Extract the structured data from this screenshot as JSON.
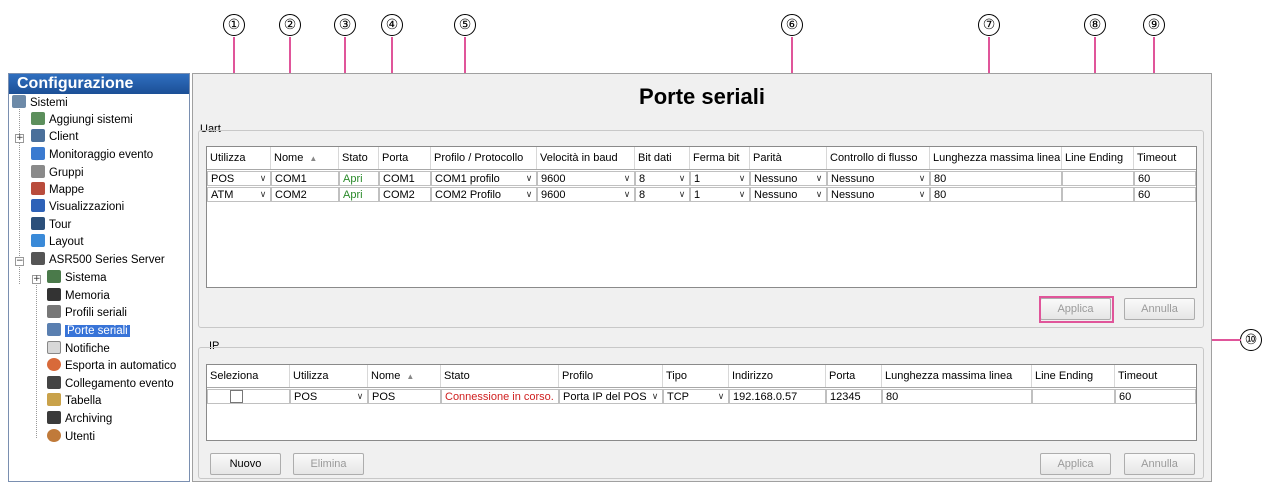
{
  "callouts": [
    "①",
    "②",
    "③",
    "④",
    "⑤",
    "⑥",
    "⑦",
    "⑧",
    "⑨",
    "⑩"
  ],
  "sidebar": {
    "title": "Configurazione",
    "items": [
      {
        "label": "Sistemi",
        "icon": "systems-icon"
      },
      {
        "label": "Aggiungi sistemi",
        "icon": "add-system-icon"
      },
      {
        "label": "Client",
        "icon": "client-icon"
      },
      {
        "label": "Monitoraggio evento",
        "icon": "event-monitor-icon"
      },
      {
        "label": "Gruppi",
        "icon": "groups-icon"
      },
      {
        "label": "Mappe",
        "icon": "maps-icon"
      },
      {
        "label": "Visualizzazioni",
        "icon": "views-icon"
      },
      {
        "label": "Tour",
        "icon": "tour-icon"
      },
      {
        "label": "Layout",
        "icon": "layout-icon"
      },
      {
        "label": "ASR500 Series Server",
        "icon": "server-icon"
      },
      {
        "label": "Sistema",
        "icon": "system-icon"
      },
      {
        "label": "Memoria",
        "icon": "memory-icon"
      },
      {
        "label": "Profili seriali",
        "icon": "serial-profiles-icon"
      },
      {
        "label": "Porte seriali",
        "icon": "serial-ports-icon"
      },
      {
        "label": "Notifiche",
        "icon": "notifications-icon"
      },
      {
        "label": "Esporta in automatico",
        "icon": "auto-export-icon"
      },
      {
        "label": "Collegamento evento",
        "icon": "event-link-icon"
      },
      {
        "label": "Tabella",
        "icon": "table-icon"
      },
      {
        "label": "Archiving",
        "icon": "archiving-icon"
      },
      {
        "label": "Utenti",
        "icon": "users-icon"
      }
    ]
  },
  "main": {
    "title": "Porte seriali",
    "uart": {
      "label": "Uart",
      "columns": [
        "Utilizza",
        "Nome",
        "Stato",
        "Porta",
        "Profilo / Protocollo",
        "Velocità in baud",
        "Bit dati",
        "Ferma bit",
        "Parità",
        "Controllo di flusso",
        "Lunghezza massima linea",
        "Line Ending",
        "Timeout"
      ],
      "rows": [
        [
          "POS",
          "COM1",
          "Apri",
          "COM1",
          "COM1 profilo",
          "9600",
          "8",
          "1",
          "Nessuno",
          "Nessuno",
          "80",
          "",
          "60"
        ],
        [
          "ATM",
          "COM2",
          "Apri",
          "COM2",
          "COM2 Profilo",
          "9600",
          "8",
          "1",
          "Nessuno",
          "Nessuno",
          "80",
          "",
          "60"
        ]
      ],
      "apply": "Applica",
      "cancel": "Annulla"
    },
    "ip": {
      "label": "IP",
      "columns": [
        "Seleziona",
        "Utilizza",
        "Nome",
        "Stato",
        "Profilo",
        "Tipo",
        "Indirizzo",
        "Porta",
        "Lunghezza massima linea",
        "Line Ending",
        "Timeout"
      ],
      "rows": [
        [
          "",
          "POS",
          "POS",
          "Connessione in corso.",
          "Porta IP del POS",
          "TCP",
          "192.168.0.57",
          "12345",
          "80",
          "",
          "60"
        ]
      ],
      "new": "Nuovo",
      "delete": "Elimina",
      "apply": "Applica",
      "cancel": "Annulla"
    }
  },
  "colors": {
    "accent_line": "#e0559a",
    "header_blue": "#1c4f96",
    "status_open": "#2a8a2a",
    "status_connecting": "#d02020"
  }
}
